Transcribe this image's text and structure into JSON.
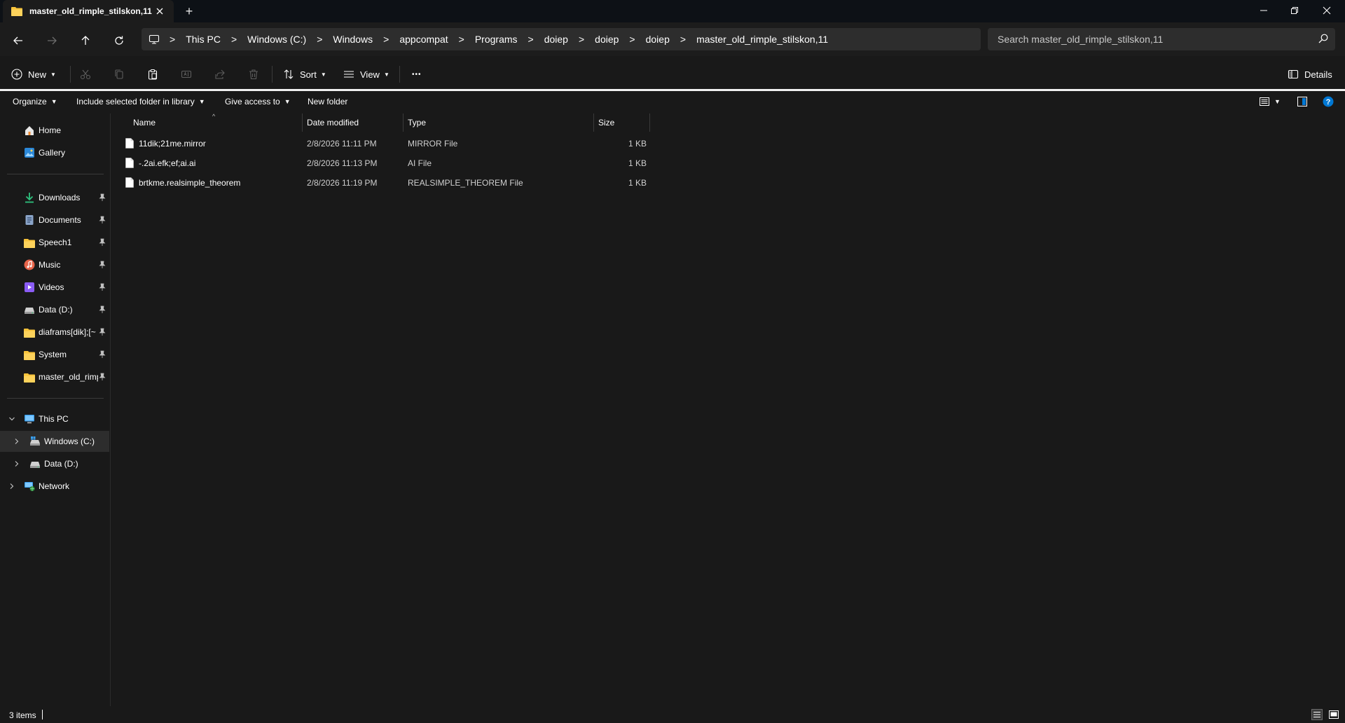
{
  "titlebar": {
    "tab_title": "master_old_rimple_stilskon,11",
    "new_tab": "+"
  },
  "nav": {
    "breadcrumbs": [
      "This PC",
      "Windows (C:)",
      "Windows",
      "appcompat",
      "Programs",
      "doiep",
      "doiep",
      "doiep",
      "master_old_rimple_stilskon,11"
    ],
    "separator": ">",
    "search_placeholder": "Search master_old_rimple_stilskon,11"
  },
  "commandbar": {
    "new_label": "New",
    "sort_label": "Sort",
    "view_label": "View",
    "more_label": "•••",
    "details_label": "Details"
  },
  "ribbon": {
    "organize": "Organize",
    "include_library": "Include selected folder in library",
    "give_access": "Give access to",
    "new_folder": "New folder"
  },
  "sidebar": {
    "quick": [
      {
        "label": "Home",
        "icon": "home-icon"
      },
      {
        "label": "Gallery",
        "icon": "gallery-icon"
      }
    ],
    "pinned": [
      {
        "label": "Downloads",
        "icon": "download-icon"
      },
      {
        "label": "Documents",
        "icon": "documents-icon"
      },
      {
        "label": "Speech1",
        "icon": "folder-icon"
      },
      {
        "label": "Music",
        "icon": "music-icon"
      },
      {
        "label": "Videos",
        "icon": "videos-icon"
      },
      {
        "label": "Data (D:)",
        "icon": "drive-icon"
      },
      {
        "label": "diaframs[dik];[~",
        "icon": "folder-icon"
      },
      {
        "label": "System",
        "icon": "folder-icon"
      },
      {
        "label": "master_old_rimp",
        "icon": "folder-icon"
      }
    ],
    "tree": [
      {
        "label": "This PC",
        "icon": "this-pc-icon"
      },
      {
        "label": "Windows (C:)",
        "icon": "windows-drive-icon"
      },
      {
        "label": "Data (D:)",
        "icon": "drive-icon"
      },
      {
        "label": "Network",
        "icon": "network-icon"
      }
    ]
  },
  "filelist": {
    "columns": {
      "name": "Name",
      "date": "Date modified",
      "type": "Type",
      "size": "Size"
    },
    "sort_indicator": "^",
    "files": [
      {
        "name": "11dik;21me.mirror",
        "date": "2/8/2026 11:11 PM",
        "type": "MIRROR File",
        "size": "1 KB"
      },
      {
        "name": "-.2ai.efk;ef;ai.ai",
        "date": "2/8/2026 11:13 PM",
        "type": "AI File",
        "size": "1 KB"
      },
      {
        "name": "brtkme.realsimple_theorem",
        "date": "2/8/2026 11:19 PM",
        "type": "REALSIMPLE_THEOREM File",
        "size": "1 KB"
      }
    ]
  },
  "status": {
    "item_count": "3 items"
  },
  "colors": {
    "background": "#191919",
    "titlebar": "#0d1116",
    "accent": "#0078d4",
    "folder": "#f8c33a"
  }
}
